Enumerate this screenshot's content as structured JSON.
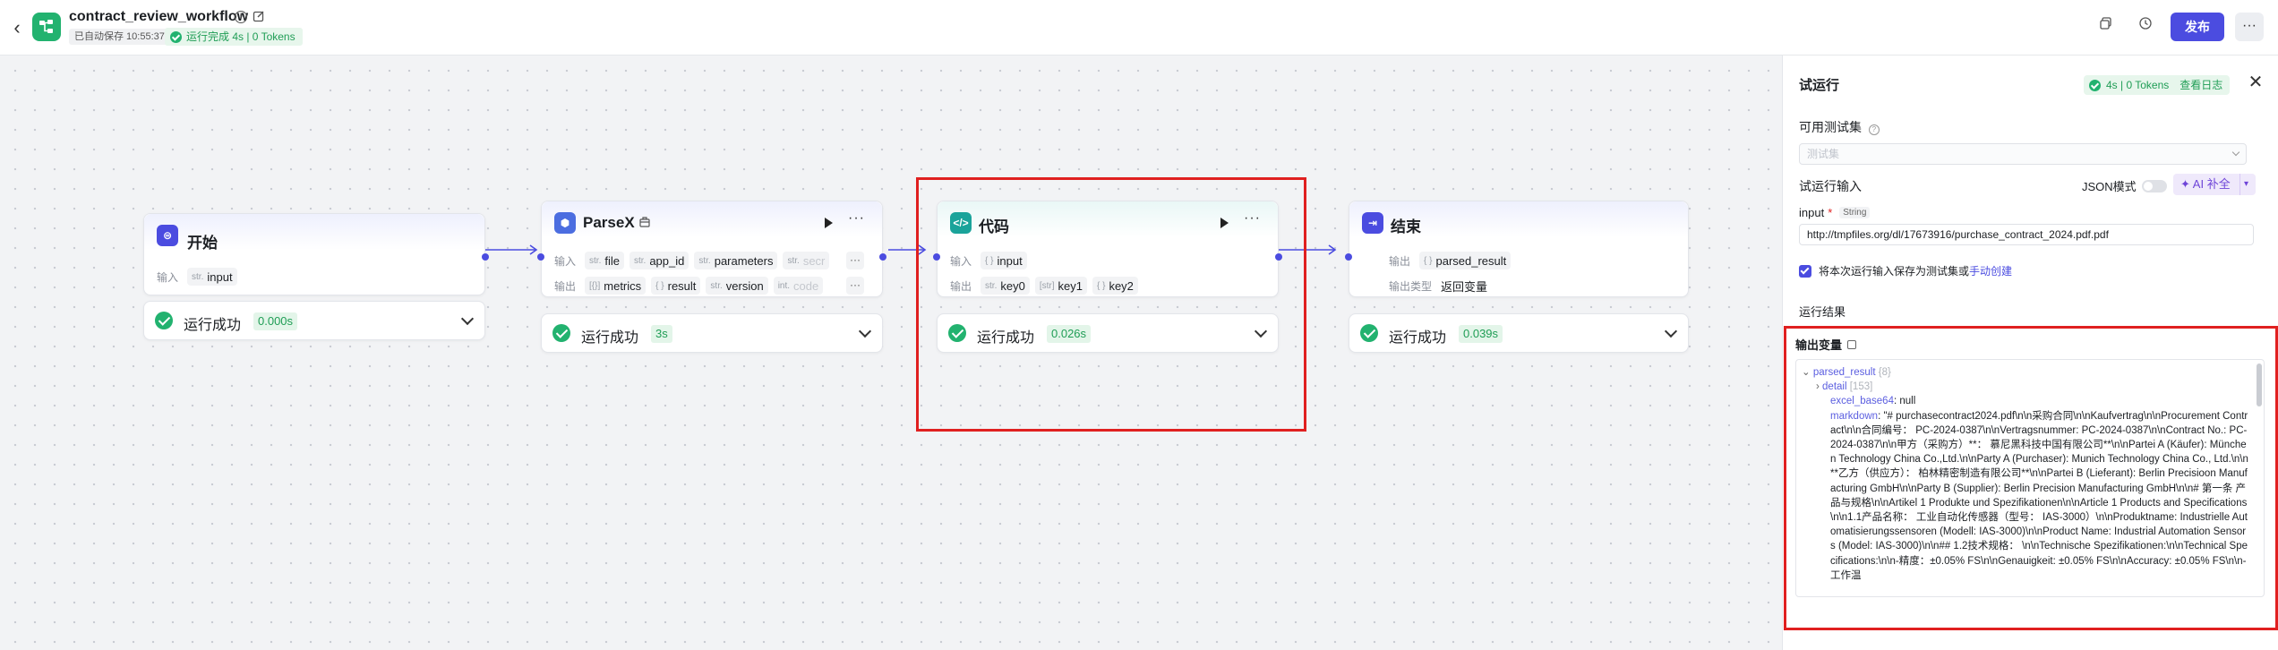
{
  "header": {
    "app_name": "contract_review_workflow",
    "autosave": "已自动保存 10:55:37",
    "run_status": "运行完成 4s | 0 Tokens",
    "publish_label": "发布",
    "more_label": "···"
  },
  "nodes": {
    "start": {
      "title": "开始",
      "input_label": "输入",
      "inputs": [
        {
          "type": "str.",
          "name": "input"
        }
      ],
      "result": "运行成功",
      "time": "0.000s"
    },
    "parsex": {
      "title": "ParseX",
      "input_label": "输入",
      "inputs": [
        {
          "type": "str.",
          "name": "file"
        },
        {
          "type": "str.",
          "name": "app_id"
        },
        {
          "type": "str.",
          "name": "parameters"
        },
        {
          "type": "str.",
          "name": "secr"
        }
      ],
      "output_label": "输出",
      "outputs": [
        {
          "type": "[{}]",
          "name": "metrics"
        },
        {
          "type": "{ }",
          "name": "result"
        },
        {
          "type": "str.",
          "name": "version"
        },
        {
          "type": "int.",
          "name": "code"
        }
      ],
      "result": "运行成功",
      "time": "3s"
    },
    "code": {
      "title": "代码",
      "input_label": "输入",
      "inputs": [
        {
          "type": "{ }",
          "name": "input"
        }
      ],
      "output_label": "输出",
      "outputs": [
        {
          "type": "str.",
          "name": "key0"
        },
        {
          "type": "[str]",
          "name": "key1"
        },
        {
          "type": "{ }",
          "name": "key2"
        }
      ],
      "result": "运行成功",
      "time": "0.026s"
    },
    "end": {
      "title": "结束",
      "output_label": "输出",
      "outputs": [
        {
          "type": "{ }",
          "name": "parsed_result"
        }
      ],
      "output_type_label": "输出类型",
      "output_type_value": "返回变量",
      "result": "运行成功",
      "time": "0.039s"
    }
  },
  "panel": {
    "title": "试运行",
    "badge": "4s | 0 Tokens",
    "view_log": "查看日志",
    "testset_label": "可用测试集",
    "testset_placeholder": "测试集",
    "run_input_label": "试运行输入",
    "json_mode_label": "JSON模式",
    "ai_fill_label": "AI 补全",
    "field_name": "input",
    "field_type": "String",
    "field_value": "http://tmpfiles.org/dl/17673916/purchase_contract_2024.pdf.pdf",
    "save_text": "将本次运行输入保存为测试集或",
    "save_link": "手动创建",
    "result_label": "运行结果",
    "output_vars_label": "输出变量",
    "tree": {
      "root_key": "parsed_result",
      "root_count": "{8}",
      "detail_key": "detail",
      "detail_count": "[153]",
      "excel_key": "excel_base64",
      "excel_value": ": null",
      "markdown_key": "markdown",
      "markdown_value": ": \"# purchasecontract2024.pdf\\n\\n采购合同\\n\\nKaufvertrag\\n\\nProcurement Contract\\n\\n合同编号： PC-2024-0387\\n\\nVertragsnummer: PC-2024-0387\\n\\nContract No.: PC-2024-0387\\n\\n甲方（采购方）**： 慕尼黑科技中国有限公司**\\n\\nPartei A (Käufer): München Technology China Co.,Ltd.\\n\\nParty A (Purchaser): Munich Technology China Co., Ltd.\\n\\n**乙方（供应方）： 柏林精密制造有限公司**\\n\\nPartei B (Lieferant): Berlin Precisioon Manufacturing GmbH\\n\\nParty B (Supplier): Berlin Precision Manufacturing GmbH\\n\\n# 第一条 产品与规格\\n\\nArtikel 1 Produkte und Spezifikationen\\n\\nArticle 1 Products and Specifications\\n\\n1.1产品名称： 工业自动化传感器（型号： IAS-3000）\\n\\nProduktname: Industrielle Automatisierungssensoren (Modell: IAS-3000)\\n\\nProduct Name: Industrial Automation Sensors (Model: IAS-3000)\\n\\n## 1.2技术规格： \\n\\nTechnische Spezifikationen:\\n\\nTechnical Specifications:\\n\\n-精度：±0.05% FS\\n\\nGenauigkeit: ±0.05% FS\\n\\nAccuracy: ±0.05% FS\\n\\n-工作温"
    }
  },
  "colors": {
    "accent": "#4b4ce0",
    "success": "#22b26f",
    "highlight": "#e02020"
  }
}
